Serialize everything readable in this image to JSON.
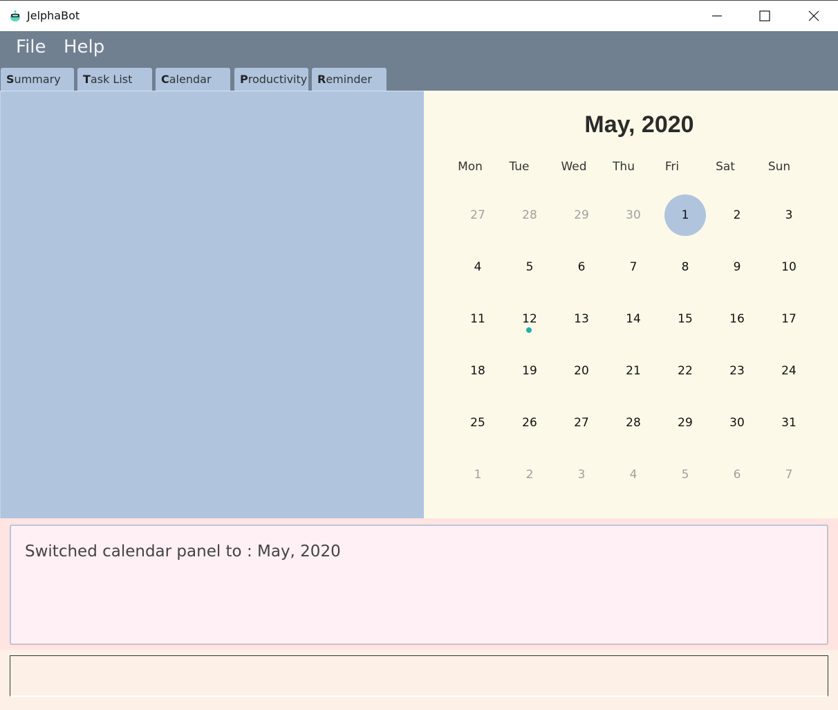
{
  "window": {
    "title": "JelphaBot",
    "icon": "robot-app-icon",
    "controls": [
      "minimize-icon",
      "maximize-icon",
      "close-icon"
    ]
  },
  "menu": {
    "items": [
      {
        "label": "File"
      },
      {
        "label": "Help"
      }
    ]
  },
  "tabs": [
    {
      "mnemonic": "S",
      "rest": "ummary"
    },
    {
      "mnemonic": "T",
      "rest": "ask List"
    },
    {
      "mnemonic": "C",
      "rest": "alendar"
    },
    {
      "mnemonic": "P",
      "rest": "roductivity"
    },
    {
      "mnemonic": "R",
      "rest": "eminder"
    }
  ],
  "calendar": {
    "title": "May, 2020",
    "weekdays": [
      "Mon",
      "Tue",
      "Wed",
      "Thu",
      "Fri",
      "Sat",
      "Sun"
    ],
    "weeks": [
      [
        {
          "d": "27",
          "muted": true
        },
        {
          "d": "28",
          "muted": true
        },
        {
          "d": "29",
          "muted": true
        },
        {
          "d": "30",
          "muted": true
        },
        {
          "d": "1",
          "today": true
        },
        {
          "d": "2"
        },
        {
          "d": "3"
        }
      ],
      [
        {
          "d": "4"
        },
        {
          "d": "5"
        },
        {
          "d": "6"
        },
        {
          "d": "7"
        },
        {
          "d": "8"
        },
        {
          "d": "9"
        },
        {
          "d": "10"
        }
      ],
      [
        {
          "d": "11"
        },
        {
          "d": "12",
          "event": true
        },
        {
          "d": "13"
        },
        {
          "d": "14"
        },
        {
          "d": "15"
        },
        {
          "d": "16"
        },
        {
          "d": "17"
        }
      ],
      [
        {
          "d": "18"
        },
        {
          "d": "19"
        },
        {
          "d": "20"
        },
        {
          "d": "21"
        },
        {
          "d": "22"
        },
        {
          "d": "23"
        },
        {
          "d": "24"
        }
      ],
      [
        {
          "d": "25"
        },
        {
          "d": "26"
        },
        {
          "d": "27"
        },
        {
          "d": "28"
        },
        {
          "d": "29"
        },
        {
          "d": "30"
        },
        {
          "d": "31"
        }
      ],
      [
        {
          "d": "1",
          "muted": true
        },
        {
          "d": "2",
          "muted": true
        },
        {
          "d": "3",
          "muted": true
        },
        {
          "d": "4",
          "muted": true
        },
        {
          "d": "5",
          "muted": true
        },
        {
          "d": "6",
          "muted": true
        },
        {
          "d": "7",
          "muted": true
        }
      ]
    ],
    "colors": {
      "today_highlight": "#b0c4de",
      "event_dot": "#20b2aa",
      "background": "#fdf9e8"
    }
  },
  "result_display": {
    "text": "Switched calendar panel to : May, 2020"
  },
  "command_box": {
    "value": "",
    "placeholder": ""
  },
  "colors": {
    "menubar": "#708090",
    "tab": "#b0c4de",
    "left_panel": "#b0c4de",
    "result_bg": "#fff0f5",
    "command_bg": "#fdf0e6"
  }
}
